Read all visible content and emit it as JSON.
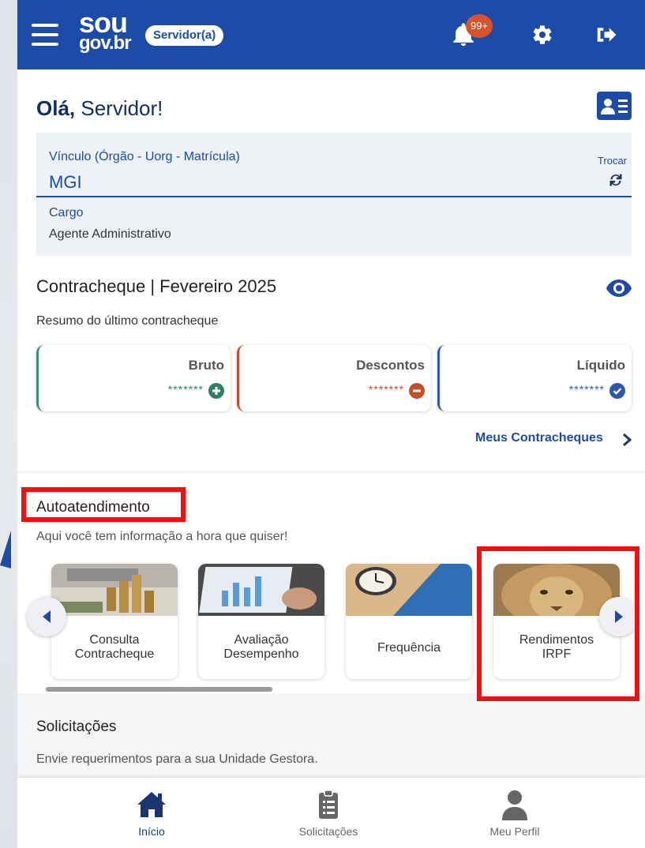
{
  "header": {
    "logo_line1": "sou",
    "logo_line2": "gov.br",
    "role_badge": "Servidor(a)",
    "notification_count": "99+"
  },
  "greeting": {
    "prefix": "Olá, ",
    "name": "Servidor!"
  },
  "vinculo": {
    "label": "Vínculo (Órgão - Uorg - Matrícula)",
    "value": "MGI",
    "trocar_label": "Trocar",
    "cargo_label": "Cargo",
    "cargo_value": "Agente Administrativo"
  },
  "contracheque": {
    "title": "Contracheque | Fevereiro 2025",
    "subtitle": "Resumo do último contracheque",
    "cards": [
      {
        "label": "Bruto",
        "value": "*******"
      },
      {
        "label": "Descontos",
        "value": "*******"
      },
      {
        "label": "Líquido",
        "value": "*******"
      }
    ],
    "link_label": "Meus Contracheques"
  },
  "autoatendimento": {
    "title": "Autoatendimento",
    "subtitle": "Aqui você tem informação a hora que quiser!",
    "services": [
      {
        "line1": "Consulta",
        "line2": "Contracheque"
      },
      {
        "line1": "Avaliação",
        "line2": "Desempenho"
      },
      {
        "line1": "Frequência",
        "line2": ""
      },
      {
        "line1": "Rendimentos",
        "line2": "IRPF"
      }
    ]
  },
  "solicitacoes": {
    "title": "Solicitações",
    "subtitle": "Envie requerimentos para a sua Unidade Gestora."
  },
  "bottom_nav": {
    "items": [
      {
        "label": "Início",
        "icon": "home-icon"
      },
      {
        "label": "Solicitações",
        "icon": "clipboard-list-icon"
      },
      {
        "label": "Meu Perfil",
        "icon": "user-icon"
      }
    ]
  },
  "colors": {
    "brand_blue": "#1c4ca8",
    "bruto_green": "#3c8e78",
    "descontos_orange": "#c2502a",
    "liquido_blue": "#2c58b4",
    "highlight_red": "#ee1111"
  }
}
